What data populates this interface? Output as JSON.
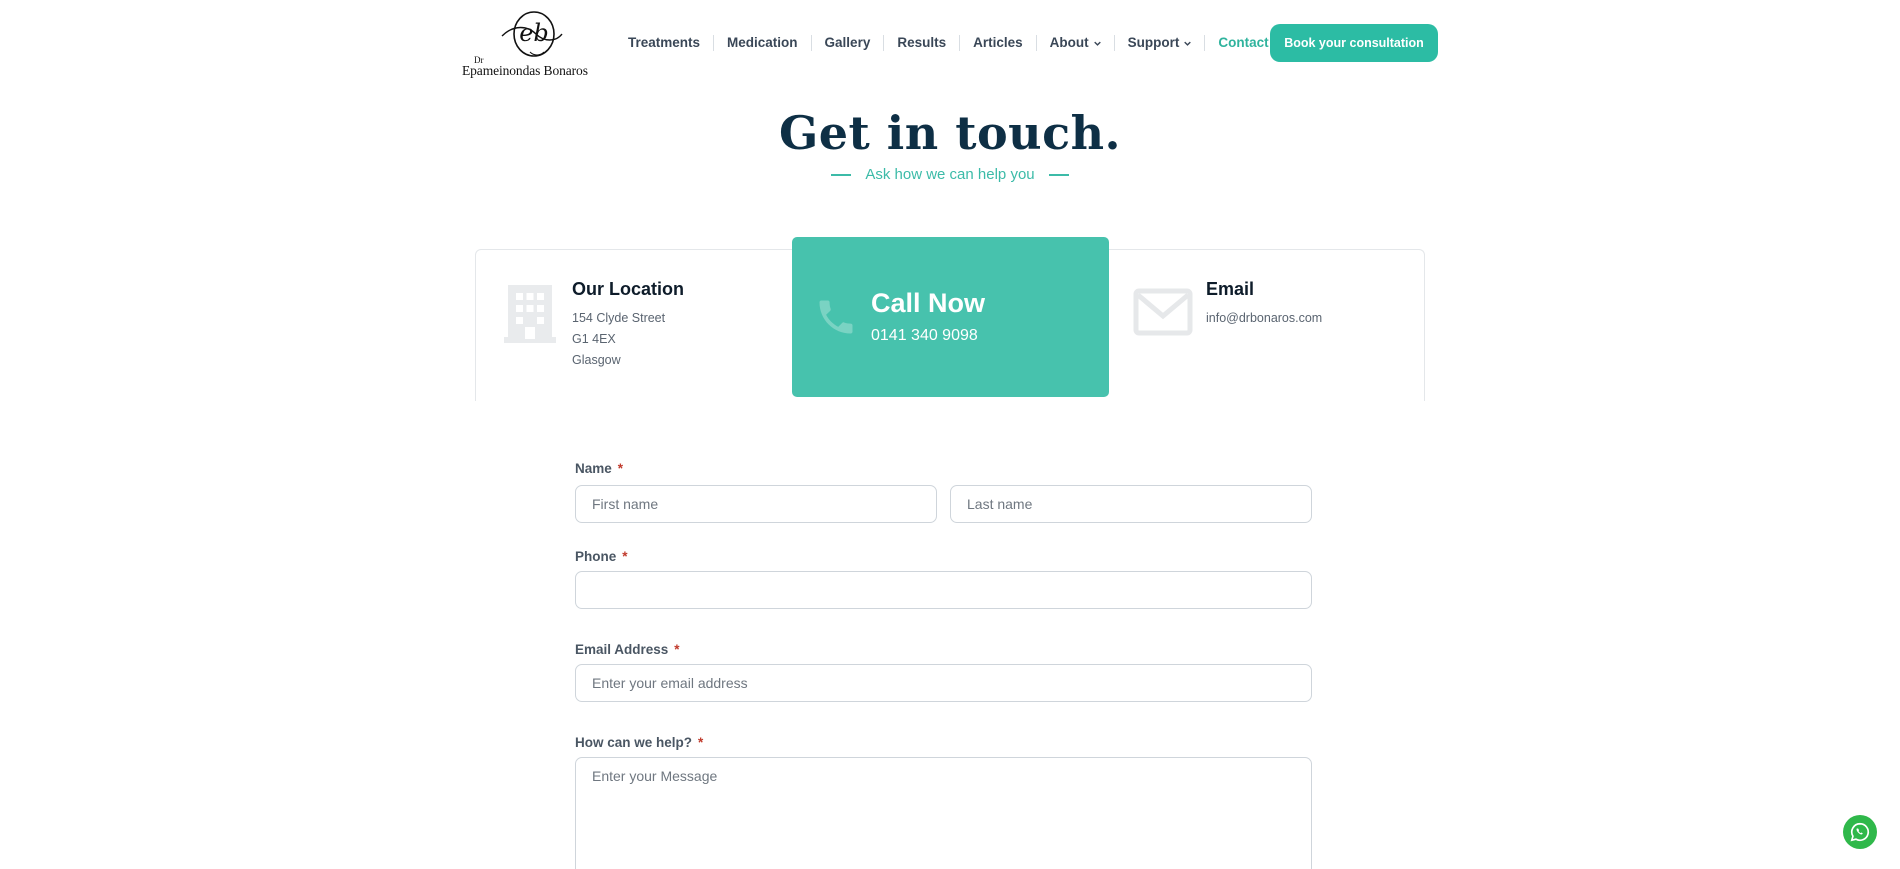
{
  "header": {
    "logo": {
      "monogram": "eb",
      "prefix": "Dr",
      "name": "Epameinondas Bonaros"
    },
    "nav": [
      {
        "label": "Treatments",
        "dropdown": false,
        "active": false
      },
      {
        "label": "Medication",
        "dropdown": false,
        "active": false
      },
      {
        "label": "Gallery",
        "dropdown": false,
        "active": false
      },
      {
        "label": "Results",
        "dropdown": false,
        "active": false
      },
      {
        "label": "Articles",
        "dropdown": false,
        "active": false
      },
      {
        "label": "About",
        "dropdown": true,
        "active": false
      },
      {
        "label": "Support",
        "dropdown": true,
        "active": false
      },
      {
        "label": "Contact",
        "dropdown": false,
        "active": true
      }
    ],
    "cta_label": "Book your consultation"
  },
  "hero": {
    "title": "Get in touch.",
    "subtitle": "Ask how we can help you"
  },
  "cards": {
    "location": {
      "title": "Our Location",
      "lines": [
        "154 Clyde Street",
        "G1 4EX",
        "Glasgow"
      ],
      "icon": "building-icon"
    },
    "call": {
      "title": "Call Now",
      "phone": "0141 340 9098",
      "icon": "phone-icon"
    },
    "email": {
      "title": "Email",
      "address": "info@drbonaros.com",
      "icon": "envelope-icon"
    }
  },
  "form": {
    "name_label": "Name",
    "first_placeholder": "First name",
    "last_placeholder": "Last name",
    "phone_label": "Phone",
    "phone_placeholder": "",
    "email_label": "Email Address",
    "email_placeholder": "Enter your email address",
    "message_label": "How can we help?",
    "message_placeholder": "Enter your Message",
    "required_marker": "*"
  },
  "colors": {
    "accent": "#2cbca4",
    "call_card": "#47c2ad",
    "heading": "#0e2f45",
    "required": "#c0392b",
    "whatsapp": "#2fb84a"
  },
  "widgets": {
    "whatsapp_icon": "whatsapp-icon"
  }
}
